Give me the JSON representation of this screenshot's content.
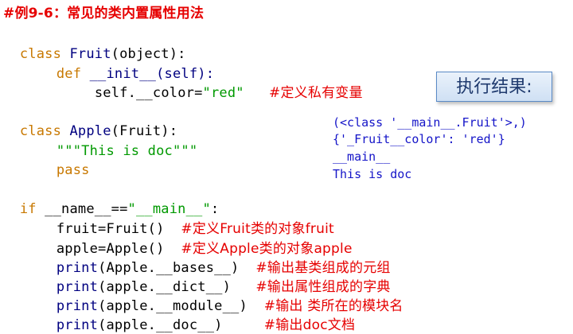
{
  "heading": "#例9-6：常见的类内置属性用法",
  "code": {
    "l1": {
      "kw": "class",
      "name": " Fruit",
      "rest": "(object):"
    },
    "l2": {
      "kw": "def",
      "rest": " __init__(self):"
    },
    "l3": {
      "code": "self.__color=",
      "str": "\"red\"",
      "comment": "#定义私有变量"
    },
    "l4": {
      "kw": "class",
      "name": " Apple",
      "rest": "(Fruit):"
    },
    "l5": {
      "str": "\"\"\"This is doc\"\"\""
    },
    "l6": {
      "kw": "pass"
    },
    "l7": {
      "kw": "if",
      "code": " __name__==",
      "str": "\"__main__\"",
      "rest": ":"
    },
    "l8": {
      "code": "fruit=Fruit()",
      "comment": "#定义Fruit类的对象fruit"
    },
    "l9": {
      "code": "apple=Apple()",
      "comment": "#定义Apple类的对象apple"
    },
    "l10": {
      "kw": "print",
      "code": "(Apple.__bases__)",
      "comment": "#输出基类组成的元组"
    },
    "l11": {
      "kw": "print",
      "code": "(apple.__dict__)",
      "comment": "#输出属性组成的字典"
    },
    "l12": {
      "kw": "print",
      "code": "(apple.__module__)",
      "comment": "#输出 类所在的模块名"
    },
    "l13": {
      "kw": "print",
      "code": "(apple.__doc__)",
      "comment": "#输出doc文档"
    }
  },
  "result_label": "执行结果:",
  "output": [
    "(<class '__main__.Fruit'>,)",
    "{'_Fruit__color': 'red'}",
    "__main__",
    "This is doc"
  ]
}
